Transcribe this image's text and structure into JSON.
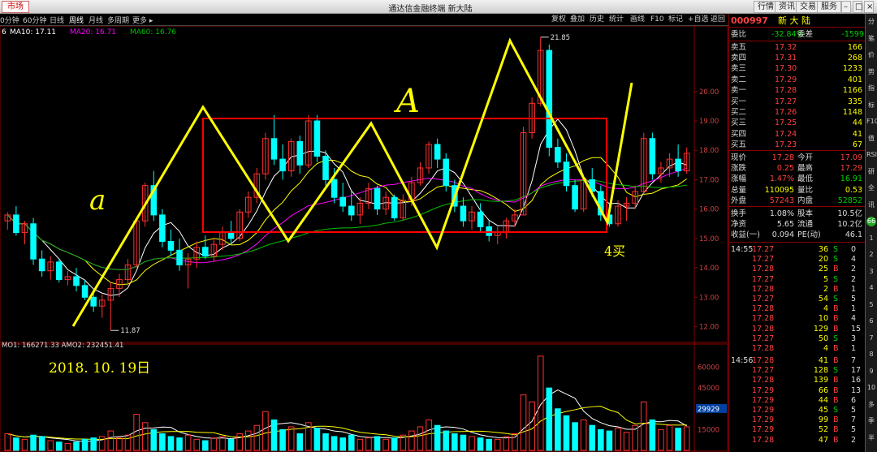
{
  "titlebar": {
    "market": "市场",
    "title": "通达信金融终端  新大陆",
    "buttons": [
      "行情",
      "资讯",
      "交易",
      "服务"
    ]
  },
  "toolbar": {
    "periods": [
      "0分钟",
      "60分钟",
      "日线",
      "周线",
      "月线",
      "多周期",
      "更多 ▸"
    ],
    "selected": "周线",
    "right": [
      "复权",
      "叠加",
      "历史",
      "统计",
      "画线",
      "F10",
      "标记",
      "+自选",
      "返回"
    ]
  },
  "ma_legend": {
    "prefix": "6",
    "ma10": "MA10: 17.11",
    "ma20": "MA20: 16.71",
    "ma60": "MA60: 16.76"
  },
  "vol_legend": "MO1: 166271.33  AMO2: 232451.41",
  "colors": {
    "up": "#ff3030",
    "down": "#00ffff",
    "ma10": "#ffffff",
    "ma20": "#ffff00",
    "ma60": "#ff00ff",
    "ma_long": "#00c000",
    "annot": "#ffff00",
    "box": "#ff0000"
  },
  "chart_data": {
    "type": "candlestick",
    "price_ticks": [
      "20.00",
      "19.00",
      "18.00",
      "17.00",
      "16.00",
      "15.00",
      "14.00",
      "13.00",
      "12.00"
    ],
    "price_range": [
      11.6,
      21.9
    ],
    "high_label": "21.85",
    "low_label": "11.87",
    "volume_ticks": [
      "60000",
      "45000",
      "30000",
      "15000"
    ],
    "volume_range": [
      0,
      72000
    ],
    "volume_marker": "29929",
    "candles": [
      [
        15.6,
        15.9,
        15.3,
        15.8
      ],
      [
        15.8,
        16.1,
        15.1,
        15.2
      ],
      [
        15.2,
        15.6,
        14.8,
        15.5
      ],
      [
        15.5,
        15.7,
        14.1,
        14.3
      ],
      [
        14.3,
        14.6,
        13.7,
        13.9
      ],
      [
        13.9,
        14.4,
        13.6,
        14.2
      ],
      [
        14.2,
        14.3,
        13.5,
        13.6
      ],
      [
        13.6,
        13.9,
        13.4,
        13.7
      ],
      [
        13.7,
        14.0,
        13.2,
        13.4
      ],
      [
        13.4,
        13.6,
        12.9,
        13.0
      ],
      [
        13.0,
        13.3,
        12.5,
        12.7
      ],
      [
        12.7,
        13.1,
        12.3,
        12.9
      ],
      [
        12.9,
        13.5,
        11.87,
        13.3
      ],
      [
        13.3,
        13.8,
        13.0,
        13.6
      ],
      [
        13.6,
        14.3,
        13.4,
        14.1
      ],
      [
        14.1,
        15.7,
        14.0,
        15.6
      ],
      [
        15.6,
        16.9,
        15.4,
        16.8
      ],
      [
        16.8,
        17.3,
        15.6,
        15.8
      ],
      [
        15.8,
        16.0,
        14.7,
        14.9
      ],
      [
        14.9,
        15.3,
        14.4,
        14.6
      ],
      [
        14.6,
        15.0,
        13.9,
        14.1
      ],
      [
        14.1,
        14.5,
        13.3,
        14.3
      ],
      [
        14.3,
        14.9,
        14.0,
        14.7
      ],
      [
        14.7,
        15.1,
        14.3,
        14.4
      ],
      [
        14.4,
        15.0,
        14.2,
        14.8
      ],
      [
        14.8,
        15.4,
        14.6,
        15.2
      ],
      [
        15.2,
        15.6,
        14.8,
        15.0
      ],
      [
        15.0,
        16.0,
        14.9,
        15.9
      ],
      [
        15.9,
        16.6,
        15.7,
        16.4
      ],
      [
        16.4,
        17.4,
        16.2,
        17.2
      ],
      [
        17.2,
        18.6,
        17.0,
        18.4
      ],
      [
        18.4,
        19.2,
        17.5,
        17.7
      ],
      [
        17.7,
        18.2,
        17.0,
        17.3
      ],
      [
        17.3,
        18.4,
        17.1,
        18.3
      ],
      [
        18.3,
        18.5,
        17.2,
        17.5
      ],
      [
        17.5,
        19.2,
        17.4,
        19.0
      ],
      [
        19.0,
        19.2,
        17.6,
        17.8
      ],
      [
        17.8,
        18.0,
        16.8,
        17.0
      ],
      [
        17.0,
        17.4,
        16.2,
        16.4
      ],
      [
        16.4,
        16.9,
        15.9,
        16.1
      ],
      [
        16.1,
        16.6,
        15.6,
        15.8
      ],
      [
        15.8,
        16.4,
        15.5,
        16.2
      ],
      [
        16.2,
        16.9,
        16.0,
        16.7
      ],
      [
        16.7,
        16.8,
        15.8,
        16.0
      ],
      [
        16.0,
        16.6,
        15.8,
        16.4
      ],
      [
        16.4,
        16.5,
        15.6,
        15.7
      ],
      [
        15.7,
        16.5,
        15.6,
        16.3
      ],
      [
        16.3,
        17.1,
        16.1,
        16.9
      ],
      [
        16.9,
        17.6,
        16.8,
        17.4
      ],
      [
        17.4,
        18.3,
        17.2,
        18.2
      ],
      [
        18.2,
        18.4,
        17.4,
        17.7
      ],
      [
        17.7,
        17.9,
        16.6,
        16.8
      ],
      [
        16.8,
        17.0,
        15.9,
        16.1
      ],
      [
        16.1,
        16.4,
        15.4,
        15.6
      ],
      [
        15.6,
        16.1,
        15.3,
        15.9
      ],
      [
        15.9,
        16.2,
        15.2,
        15.4
      ],
      [
        15.4,
        15.6,
        14.9,
        15.1
      ],
      [
        15.1,
        15.4,
        14.8,
        15.2
      ],
      [
        15.2,
        15.7,
        15.0,
        15.6
      ],
      [
        15.6,
        16.0,
        15.4,
        15.8
      ],
      [
        15.8,
        18.8,
        15.8,
        18.6
      ],
      [
        18.6,
        19.8,
        18.4,
        19.6
      ],
      [
        19.6,
        21.85,
        19.5,
        21.4
      ],
      [
        21.4,
        21.6,
        17.8,
        18.1
      ],
      [
        18.1,
        18.4,
        17.4,
        17.6
      ],
      [
        17.6,
        17.9,
        16.6,
        16.8
      ],
      [
        16.8,
        17.0,
        15.9,
        16.0
      ],
      [
        16.0,
        17.2,
        15.9,
        17.0
      ],
      [
        17.0,
        17.4,
        16.4,
        16.6
      ],
      [
        16.6,
        16.8,
        15.6,
        15.8
      ],
      [
        15.8,
        16.2,
        15.4,
        15.5
      ],
      [
        15.5,
        16.3,
        15.4,
        16.1
      ],
      [
        16.1,
        16.4,
        15.6,
        16.2
      ],
      [
        16.2,
        16.8,
        16.0,
        16.6
      ],
      [
        16.6,
        18.6,
        16.5,
        18.4
      ],
      [
        18.4,
        18.6,
        17.0,
        17.2
      ],
      [
        17.2,
        17.6,
        16.9,
        17.4
      ],
      [
        17.4,
        17.9,
        17.1,
        17.7
      ],
      [
        17.7,
        18.2,
        17.1,
        17.3
      ],
      [
        17.3,
        18.1,
        17.2,
        17.9
      ]
    ],
    "volumes": [
      12000,
      9000,
      8000,
      11000,
      10000,
      7000,
      6000,
      5000,
      6000,
      8000,
      9000,
      10000,
      14000,
      9000,
      11000,
      26000,
      20000,
      15000,
      12000,
      10000,
      9000,
      11000,
      8000,
      7000,
      9000,
      10000,
      8000,
      12000,
      14000,
      18000,
      28000,
      22000,
      15000,
      17000,
      12000,
      20000,
      16000,
      12000,
      10000,
      9000,
      11000,
      8000,
      9000,
      10000,
      8000,
      9000,
      11000,
      14000,
      17000,
      22000,
      18000,
      14000,
      12000,
      11000,
      10000,
      9000,
      8000,
      8000,
      10000,
      12000,
      40000,
      35000,
      68000,
      45000,
      30000,
      25000,
      20000,
      22000,
      18000,
      15000,
      14000,
      16000,
      13000,
      18000,
      35000,
      22000,
      15000,
      18000,
      16000,
      17000
    ]
  },
  "annotations": {
    "small_a": "a",
    "big_a": "A",
    "date": "2018. 10. 19日",
    "buy": "4买"
  },
  "quote": {
    "code": "000997",
    "name": "新 大 陆",
    "weibi_label": "委比",
    "weibi": "-32.84%",
    "weicha_label": "委差",
    "weicha": "-1599",
    "asks": [
      [
        "卖五",
        "17.32",
        "166"
      ],
      [
        "卖四",
        "17.31",
        "268"
      ],
      [
        "卖三",
        "17.30",
        "1233"
      ],
      [
        "卖二",
        "17.29",
        "401"
      ],
      [
        "卖一",
        "17.28",
        "1166"
      ]
    ],
    "bids": [
      [
        "买一",
        "17.27",
        "335"
      ],
      [
        "买二",
        "17.26",
        "1148"
      ],
      [
        "买三",
        "17.25",
        "44"
      ],
      [
        "买四",
        "17.24",
        "41"
      ],
      [
        "买五",
        "17.23",
        "67"
      ]
    ],
    "stats": [
      [
        "现价",
        "17.28",
        "今开",
        "17.09"
      ],
      [
        "涨跌",
        "0.25",
        "最高",
        "17.29"
      ],
      [
        "涨幅",
        "1.47%",
        "最低",
        "16.91"
      ],
      [
        "总量",
        "110095",
        "量比",
        "0.53"
      ],
      [
        "外盘",
        "57243",
        "内盘",
        "52852"
      ]
    ],
    "stats2": [
      [
        "换手",
        "1.08%",
        "股本",
        "10.5亿"
      ],
      [
        "净资",
        "5.65",
        "流通",
        "10.2亿"
      ],
      [
        "收益(一)",
        "0.094",
        "PE(动)",
        "46.1"
      ]
    ],
    "time1": "14:55",
    "time2": "14:56",
    "ticks1": [
      [
        "17.27",
        "36",
        "S",
        "0"
      ],
      [
        "17.27",
        "20",
        "S",
        "4"
      ],
      [
        "17.28",
        "25",
        "B",
        "2"
      ],
      [
        "17.27",
        "5",
        "S",
        "2"
      ],
      [
        "17.28",
        "2",
        "B",
        "1"
      ],
      [
        "17.27",
        "54",
        "S",
        "5"
      ],
      [
        "17.28",
        "4",
        "B",
        "1"
      ],
      [
        "17.28",
        "10",
        "B",
        "4"
      ],
      [
        "17.28",
        "129",
        "B",
        "15"
      ],
      [
        "17.27",
        "50",
        "S",
        "3"
      ],
      [
        "17.28",
        "4",
        "B",
        "1"
      ]
    ],
    "ticks2": [
      [
        "17.28",
        "41",
        "B",
        "7"
      ],
      [
        "17.27",
        "128",
        "S",
        "17"
      ],
      [
        "17.28",
        "139",
        "B",
        "16"
      ],
      [
        "17.29",
        "66",
        "B",
        "13"
      ],
      [
        "17.29",
        "44",
        "B",
        "6"
      ],
      [
        "17.29",
        "45",
        "S",
        "5"
      ],
      [
        "17.29",
        "99",
        "B",
        "7"
      ],
      [
        "17.29",
        "52",
        "B",
        "5"
      ],
      [
        "17.28",
        "47",
        "B",
        "2"
      ]
    ]
  },
  "sidebar": [
    "分",
    "笔",
    "价",
    "势",
    "指",
    "标",
    "F10",
    "值",
    "RSI",
    "研",
    "全",
    "讯",
    "66",
    "1",
    "2",
    "3",
    "4",
    "5",
    "6",
    "7",
    "8",
    "9",
    "10",
    "多",
    "季",
    "半"
  ]
}
